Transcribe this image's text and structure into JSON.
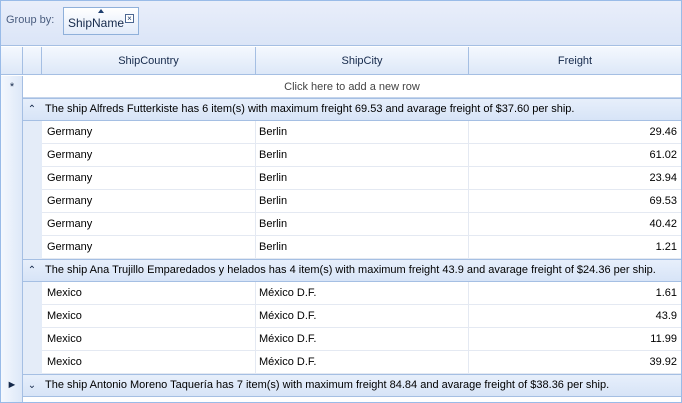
{
  "group_panel": {
    "label": "Group by:",
    "chip": {
      "name": "ShipName",
      "sort": "ascending",
      "close_icon": "close-icon"
    }
  },
  "columns": [
    "ShipCountry",
    "ShipCity",
    "Freight"
  ],
  "new_row_text": "Click here to add a new row",
  "new_row_indicator": "*",
  "current_row_indicator": "►",
  "groups": [
    {
      "expanded": true,
      "summary": "The ship Alfreds Futterkiste has 6 item(s) with maximum freight 69.53 and avarage freight of $37.60 per ship.",
      "rows": [
        {
          "country": "Germany",
          "city": "Berlin",
          "freight": "29.46"
        },
        {
          "country": "Germany",
          "city": "Berlin",
          "freight": "61.02"
        },
        {
          "country": "Germany",
          "city": "Berlin",
          "freight": "23.94"
        },
        {
          "country": "Germany",
          "city": "Berlin",
          "freight": "69.53"
        },
        {
          "country": "Germany",
          "city": "Berlin",
          "freight": "40.42"
        },
        {
          "country": "Germany",
          "city": "Berlin",
          "freight": "1.21"
        }
      ]
    },
    {
      "expanded": true,
      "summary": "The ship Ana Trujillo Emparedados y helados has 4 item(s) with maximum freight 43.9 and avarage freight of $24.36 per ship.",
      "rows": [
        {
          "country": "Mexico",
          "city": "México D.F.",
          "freight": "1.61"
        },
        {
          "country": "Mexico",
          "city": "México D.F.",
          "freight": "43.9"
        },
        {
          "country": "Mexico",
          "city": "México D.F.",
          "freight": "11.99"
        },
        {
          "country": "Mexico",
          "city": "México D.F.",
          "freight": "39.92"
        }
      ]
    },
    {
      "expanded": false,
      "current": true,
      "summary": "The ship Antonio Moreno Taquería has 7 item(s) with maximum freight 84.84 and avarage freight of $38.36 per ship.",
      "rows": []
    }
  ]
}
